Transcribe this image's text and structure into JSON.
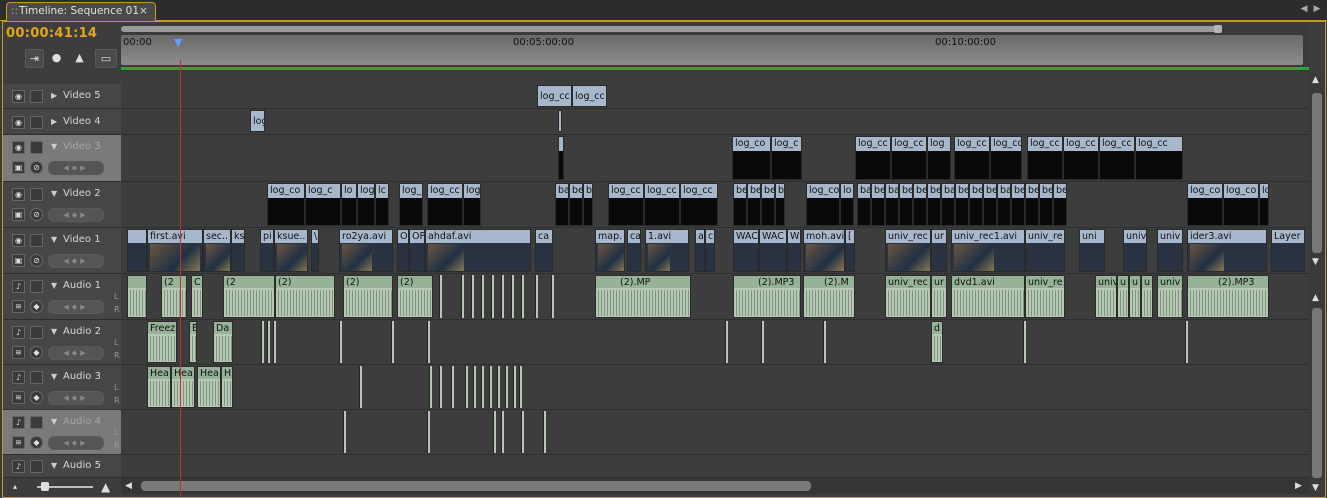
{
  "panel": {
    "tab_title": "Timeline: Sequence 01",
    "tab_grip": "::",
    "close_glyph": "×",
    "timecode": "00:00:41:14"
  },
  "ruler": {
    "labels": [
      "00:00",
      "00:05:00:00",
      "00:10:00:00"
    ]
  },
  "tracks": {
    "video5": {
      "name": "Video 5"
    },
    "video4": {
      "name": "Video 4"
    },
    "video3": {
      "name": "Video 3"
    },
    "video2": {
      "name": "Video 2"
    },
    "video1": {
      "name": "Video 1"
    },
    "audio1": {
      "name": "Audio 1"
    },
    "audio2": {
      "name": "Audio 2"
    },
    "audio3": {
      "name": "Audio 3"
    },
    "audio4": {
      "name": "Audio 4"
    },
    "audio5": {
      "name": "Audio 5"
    },
    "lr_left": "L",
    "lr_right": "R"
  },
  "clips": {
    "v5": [
      "log_cc",
      "log_cc"
    ],
    "v4": [
      "log"
    ],
    "v3": [
      "log_co",
      "log_c",
      "log_cc",
      "log_cc",
      "log",
      "log_cc",
      "log_cc",
      "log_cc",
      "log_cc",
      "log_cc",
      "log_cc"
    ],
    "v2": [
      "log_co",
      "log_c",
      "lo",
      "log",
      "lc",
      "log_",
      "log_cc",
      "log",
      "ba",
      "be",
      "b",
      "log_cc",
      "log_cc",
      "log_cc",
      "be",
      "be",
      "be",
      "b",
      "log_co",
      "lo",
      "ba",
      "be",
      "ba",
      "be",
      "be",
      "be",
      "ba",
      "be",
      "be",
      "be",
      "ba",
      "be",
      "be",
      "be",
      "be",
      "log_co",
      "log_co",
      "lo"
    ],
    "v1": [
      "first.avi",
      "sec..",
      "ks",
      "pi",
      "ksue..",
      "\\",
      "ro2ya.avi",
      "O",
      "OP",
      "ahdaf.avi",
      "ca",
      "map.",
      "ca",
      "1.avi",
      "a",
      "c",
      "WAC",
      "WAC",
      "W",
      "moh.avi",
      "[",
      "univ_rec",
      "ur",
      "univ_rec1.avi",
      "univ_re",
      "uni",
      "univ",
      "univ",
      "ider3.avi",
      "Layer"
    ],
    "a1": [
      "(2",
      "C",
      "(2",
      "(2)",
      "(2)",
      "(2)",
      "(2).MP",
      "(2).MP3",
      "(2).M",
      "univ_rec",
      "ur",
      "dvd1.avi",
      "univ_re",
      "univ",
      "u",
      "u",
      "u",
      "univ",
      "(2).MP3"
    ],
    "a2": [
      "Freez",
      "E",
      "Da",
      "d"
    ],
    "a3": [
      "Hea",
      "Hea",
      "Hea",
      "H"
    ]
  }
}
